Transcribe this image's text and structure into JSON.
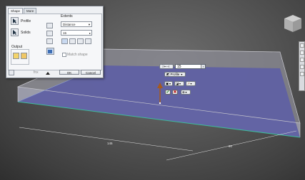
{
  "dialog": {
    "tabs": [
      "Shape",
      "More"
    ],
    "profile_label": "Profile",
    "solids_label": "Solids",
    "output_label": "Output",
    "extents_label": "Extents",
    "extents_value": "Distance",
    "distance_value": "15",
    "match_shape_label": "Match shape",
    "ok_label": "OK",
    "cancel_label": "Cancel",
    "link_label": "fnx"
  },
  "minitoolbar": {
    "distance_value": "15",
    "profile_label": "Profile"
  },
  "dimensions": {
    "length": "145",
    "width": "90"
  },
  "colors": {
    "accent_top": "#7b7fa8",
    "edge_highlight": "#3dbb9a",
    "arrow": "#a65a1e",
    "ok_green": "#2a8a2a",
    "cancel_red": "#c02020"
  },
  "icons": {
    "ok": "✔",
    "cancel": "✖"
  }
}
